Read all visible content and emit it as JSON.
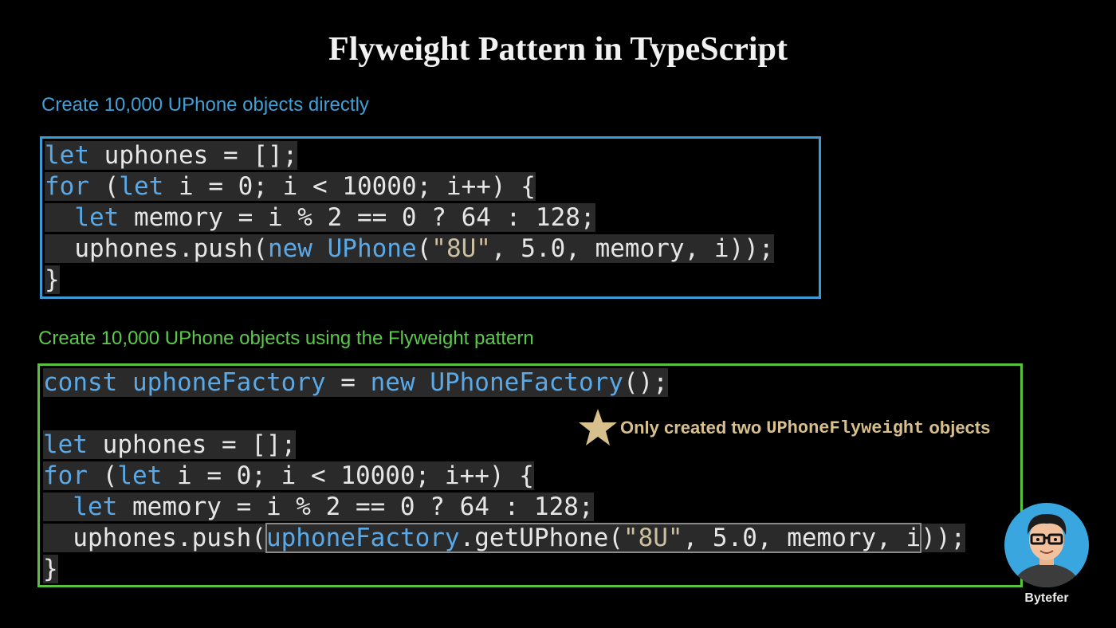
{
  "title": "Flyweight Pattern in TypeScript",
  "caption_direct": "Create 10,000 UPhone objects directly",
  "caption_flyweight": "Create 10,000 UPhone objects using the Flyweight pattern",
  "code_direct": {
    "l1": {
      "kw": "let",
      "rest": " uphones = [];"
    },
    "l2": {
      "kw1": "for",
      "a": " (",
      "kw2": "let",
      "b": " i = 0; i < 10000; i++) {"
    },
    "l3": {
      "ind": "  ",
      "kw": "let",
      "rest": " memory = i % 2 == 0 ? 64 : 128;"
    },
    "l4": {
      "a": "  uphones.push(",
      "kw1": "new",
      "sp": " ",
      "kw2": "UPhone",
      "b": "(",
      "str": "\"8U\"",
      "c": ", 5.0, memory, i));"
    },
    "l5": "}"
  },
  "code_flyweight": {
    "l1": {
      "kw1": "const",
      "sp1": " ",
      "kw2": "uphoneFactory",
      "a": " = ",
      "kw3": "new",
      "sp2": " ",
      "kw4": "UPhoneFactory",
      "b": "();"
    },
    "l3": {
      "kw": "let",
      "rest": " uphones = [];"
    },
    "l4": {
      "kw1": "for",
      "a": " (",
      "kw2": "let",
      "b": " i = 0; i < 10000; i++) {"
    },
    "l5": {
      "ind": "  ",
      "kw": "let",
      "rest": " memory = i % 2 == 0 ? 64 : 128;"
    },
    "l6": {
      "a": "  uphones.push(",
      "kw": "uphoneFactory",
      "b": ".getUPhone(",
      "str": "\"8U\"",
      "c": ", 5.0, memory, i",
      "d": "));"
    },
    "l7": "}"
  },
  "note": {
    "pre": "Only created two",
    "mono": "UPhoneFlyweight",
    "post": "objects",
    "icon": "star-icon"
  },
  "brand": "Bytefer",
  "colors": {
    "blue": "#3d9bd3",
    "green": "#58c23f",
    "keyword": "#5aa9e6",
    "string": "#cdbfa0",
    "note": "#d8c08c"
  }
}
